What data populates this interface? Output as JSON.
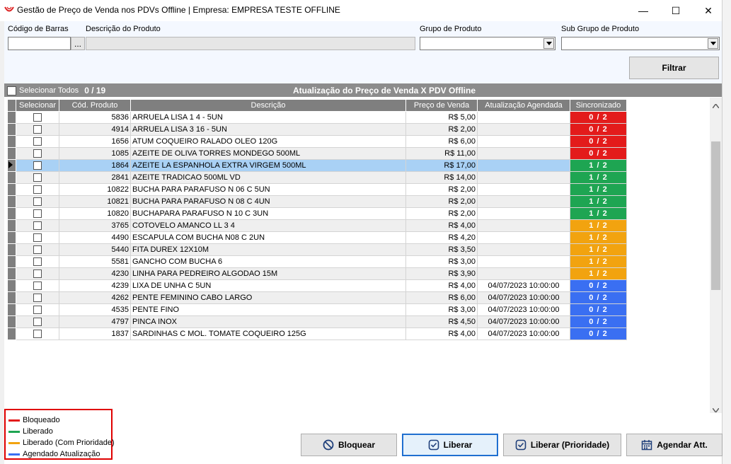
{
  "window": {
    "title": "Gestão de Preço de Venda nos PDVs Offline | Empresa: EMPRESA TESTE OFFLINE",
    "minimize_glyph": "—",
    "maximize_glyph": "☐",
    "close_glyph": "✕"
  },
  "filters": {
    "barcode_label": "Código de Barras",
    "barcode_value": "",
    "lookup_button": "...",
    "description_label": "Descrição do Produto",
    "description_value": "",
    "group_label": "Grupo de Produto",
    "group_value": "",
    "subgroup_label": "Sub Grupo de Produto",
    "subgroup_value": "",
    "filter_button": "Filtrar"
  },
  "grid_header": {
    "select_all_label": "Selecionar Todos",
    "selected_count": "0 / 19",
    "title": "Atualização do Preço de Venda X PDV Offline"
  },
  "columns": [
    "Selecionar",
    "Cód. Produto",
    "Descrição",
    "Preço de Venda",
    "Atualização Agendada",
    "Sincronizado"
  ],
  "rows": [
    {
      "code": "5836",
      "desc": "ARRUELA LISA 1 4 - 5UN",
      "price": "R$ 5,00",
      "scheduled": "",
      "sync": "0 / 2",
      "status": "bloqueado"
    },
    {
      "code": "4914",
      "desc": "ARRUELA LISA 3 16 - 5UN",
      "price": "R$ 2,00",
      "scheduled": "",
      "sync": "0 / 2",
      "status": "bloqueado"
    },
    {
      "code": "1656",
      "desc": "ATUM COQUEIRO RALADO OLEO 120G",
      "price": "R$ 6,00",
      "scheduled": "",
      "sync": "0 / 2",
      "status": "bloqueado"
    },
    {
      "code": "1085",
      "desc": "AZEITE DE OLIVA TORRES MONDEGO 500ML",
      "price": "R$ 11,00",
      "scheduled": "",
      "sync": "0 / 2",
      "status": "bloqueado"
    },
    {
      "code": "1864",
      "desc": "AZEITE LA ESPANHOLA EXTRA VIRGEM 500ML",
      "price": "R$ 17,00",
      "scheduled": "",
      "sync": "1 / 2",
      "status": "liberado"
    },
    {
      "code": "2841",
      "desc": "AZEITE TRADICAO 500ML VD",
      "price": "R$ 14,00",
      "scheduled": "",
      "sync": "1 / 2",
      "status": "liberado"
    },
    {
      "code": "10822",
      "desc": "BUCHA PARA PARAFUSO  N 06 C 5UN",
      "price": "R$ 2,00",
      "scheduled": "",
      "sync": "1 / 2",
      "status": "liberado"
    },
    {
      "code": "10821",
      "desc": "BUCHA PARA PARAFUSO  N 08 C 4UN",
      "price": "R$ 2,00",
      "scheduled": "",
      "sync": "1 / 2",
      "status": "liberado"
    },
    {
      "code": "10820",
      "desc": "BUCHAPARA PARAFUSO  N 10 C 3UN",
      "price": "R$ 2,00",
      "scheduled": "",
      "sync": "1 / 2",
      "status": "liberado"
    },
    {
      "code": "3765",
      "desc": "COTOVELO AMANCO LL 3 4",
      "price": "R$ 4,00",
      "scheduled": "",
      "sync": "1 / 2",
      "status": "prioridade"
    },
    {
      "code": "4490",
      "desc": "ESCAPULA COM BUCHA N08 C 2UN",
      "price": "R$ 4,20",
      "scheduled": "",
      "sync": "1 / 2",
      "status": "prioridade"
    },
    {
      "code": "5440",
      "desc": "FITA DUREX 12X10M",
      "price": "R$ 3,50",
      "scheduled": "",
      "sync": "1 / 2",
      "status": "prioridade"
    },
    {
      "code": "5581",
      "desc": "GANCHO COM BUCHA 6",
      "price": "R$ 3,00",
      "scheduled": "",
      "sync": "1 / 2",
      "status": "prioridade"
    },
    {
      "code": "4230",
      "desc": "LINHA PARA PEDREIRO ALGODAO 15M",
      "price": "R$ 3,90",
      "scheduled": "",
      "sync": "1 / 2",
      "status": "prioridade"
    },
    {
      "code": "4239",
      "desc": "LIXA DE UNHA C 5UN",
      "price": "R$ 4,00",
      "scheduled": "04/07/2023 10:00:00",
      "sync": "0 / 2",
      "status": "agendado"
    },
    {
      "code": "4262",
      "desc": "PENTE FEMININO CABO LARGO",
      "price": "R$ 6,00",
      "scheduled": "04/07/2023 10:00:00",
      "sync": "0 / 2",
      "status": "agendado"
    },
    {
      "code": "4535",
      "desc": "PENTE FINO",
      "price": "R$ 3,00",
      "scheduled": "04/07/2023 10:00:00",
      "sync": "0 / 2",
      "status": "agendado"
    },
    {
      "code": "4797",
      "desc": "PINCA INOX",
      "price": "R$ 4,50",
      "scheduled": "04/07/2023 10:00:00",
      "sync": "0 / 2",
      "status": "agendado"
    },
    {
      "code": "1837",
      "desc": "SARDINHAS C MOL. TOMATE COQUEIRO 125G",
      "price": "R$ 4,00",
      "scheduled": "04/07/2023 10:00:00",
      "sync": "0 / 2",
      "status": "agendado"
    }
  ],
  "selected_row_index": 4,
  "status_colors": {
    "bloqueado": "#e31b1b",
    "liberado": "#1ea552",
    "prioridade": "#f2a30f",
    "agendado": "#3a6ff2"
  },
  "legend": [
    {
      "label": "Bloqueado",
      "status": "bloqueado"
    },
    {
      "label": "Liberado",
      "status": "liberado"
    },
    {
      "label": "Liberado (Com Prioridade)",
      "status": "prioridade"
    },
    {
      "label": "Agendado Atualização",
      "status": "agendado"
    }
  ],
  "actions": {
    "block": "Bloquear",
    "release": "Liberar",
    "release_priority": "Liberar (Prioridade)",
    "schedule": "Agendar Att."
  }
}
